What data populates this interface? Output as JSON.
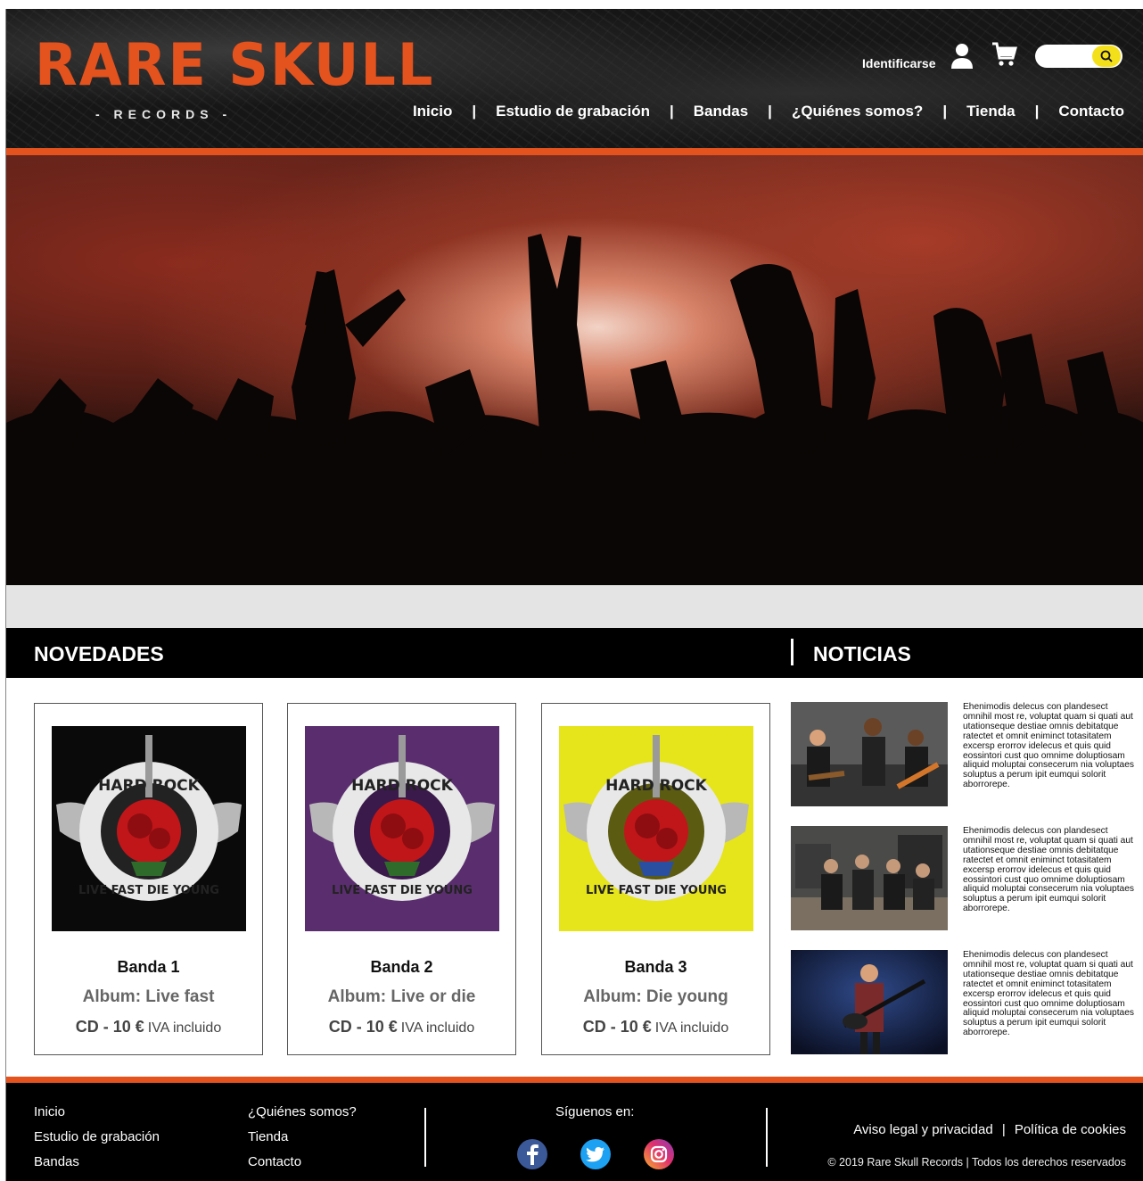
{
  "header": {
    "logo_title": "RARE SKULL",
    "logo_subtitle": "- RECORDS -",
    "login_label": "Identificarse"
  },
  "nav": {
    "items": [
      "Inicio",
      "Estudio de grabación",
      "Bandas",
      "¿Quiénes somos?",
      "Tienda",
      "Contacto"
    ],
    "separator": "|"
  },
  "sections": {
    "news_releases": "NOVEDADES",
    "news": "NOTICIAS"
  },
  "products": [
    {
      "band": "Banda 1",
      "album": "Album: Live fast",
      "price": "CD - 10 €",
      "tax": "IVA incluido",
      "cover_bg": "#0a0a0a"
    },
    {
      "band": "Banda 2",
      "album": "Album: Live or die",
      "price": "CD - 10 €",
      "tax": "IVA incluido",
      "cover_bg": "#5a2e6e"
    },
    {
      "band": "Banda 3",
      "album": "Album: Die young",
      "price": "CD - 10 €",
      "tax": "IVA incluido",
      "cover_bg": "#e6e41a"
    }
  ],
  "cover_art": {
    "top_text": "HARD ROCK",
    "bottom_text": "LIVE FAST DIE YOUNG"
  },
  "news_items": [
    {
      "text": "Ehenimodis delecus con plandesect omnihil most re, voluptat quam si quati aut utationseque destiae omnis debitatque ratectet et omnit eniminct totasitatem excersp erorrov idelecus et quis quid eossintori cust quo omnime doluptiosam aliquid moluptai consecerum nia voluptaes soluptus a perum ipit eumqui solorit aborrorepe."
    },
    {
      "text": "Ehenimodis delecus con plandesect omnihil most re, voluptat quam si quati aut utationseque destiae omnis debitatque ratectet et omnit eniminct totasitatem excersp erorrov idelecus et quis quid eossintori cust quo omnime doluptiosam aliquid moluptai consecerum nia voluptaes soluptus a perum ipit eumqui solorit aborrorepe."
    },
    {
      "text": "Ehenimodis delecus con plandesect omnihil most re, voluptat quam si quati aut utationseque destiae omnis debitatque ratectet et omnit eniminct totasitatem excersp erorrov idelecus et quis quid eossintori cust quo omnime doluptiosam aliquid moluptai consecerum nia voluptaes soluptus a perum ipit eumqui solorit aborrorepe."
    }
  ],
  "footer": {
    "col1": [
      "Inicio",
      "Estudio de grabación",
      "Bandas"
    ],
    "col2": [
      "¿Quiénes somos?",
      "Tienda",
      "Contacto"
    ],
    "follow_label": "Síguenos en:",
    "social": [
      {
        "icon": "facebook-icon",
        "color": "#3b5998"
      },
      {
        "icon": "twitter-icon",
        "color": "#1da1f2"
      },
      {
        "icon": "instagram-icon",
        "color": "#d6246e"
      }
    ],
    "legal_link": "Aviso legal y privacidad",
    "cookies_link": "Política de cookies",
    "legal_separator": "|",
    "copyright": "© 2019 Rare Skull Records | Todos los derechos reservados"
  },
  "colors": {
    "accent": "#e4521e",
    "search_button": "#f4e01a"
  }
}
